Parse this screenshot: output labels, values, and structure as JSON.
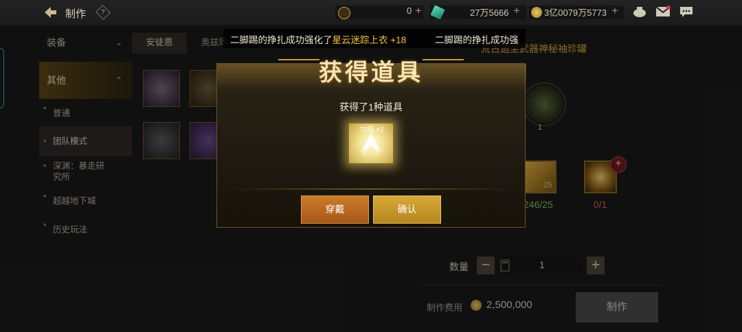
{
  "header": {
    "title": "制作",
    "help_label": "?",
    "currency1_value": "0",
    "currency2_value": "27万5666",
    "currency3_value": "3亿0079万5773",
    "plus_symbol": "+"
  },
  "sidebar": {
    "equip_label": "装备",
    "other_label": "其他",
    "items": [
      {
        "label": "普通"
      },
      {
        "label": "团队模式"
      },
      {
        "label": "深渊：暴走研究所"
      },
      {
        "label": "超越地下城"
      },
      {
        "label": "历史玩法"
      }
    ]
  },
  "tabs": [
    {
      "label": "安徒恩"
    },
    {
      "label": "奥兹玛"
    }
  ],
  "right_panel": {
    "item_title": "荒古遗尘武器神秘袖珍罐",
    "jar_count": "1",
    "mat1_count": "25",
    "mat1_progress": "246/25",
    "mat2_progress": "0/1",
    "add_label": "+",
    "qty_label": "数量",
    "qty_minus": "−",
    "qty_plus": "+",
    "qty_value": "1",
    "cost_label": "制作费用",
    "cost_value": "2,500,000",
    "make_button": "制作"
  },
  "ticker": {
    "text_a": "二脚踢的挣扎成功强化了",
    "text_hl": "星云迷踪上衣 +18",
    "text_b": "二脚踢的挣扎成功强"
  },
  "dialog": {
    "title": "获得道具",
    "message": "获得了1种道具",
    "reward_label": "70级 +2",
    "wear_button": "穿戴",
    "confirm_button": "确认"
  },
  "colors": {
    "accent_gold": "#d3a53a",
    "progress_green": "#7fc35a",
    "progress_red": "#e05a5a",
    "wear_orange": "#b9611f",
    "confirm_gold": "#c6952a"
  }
}
